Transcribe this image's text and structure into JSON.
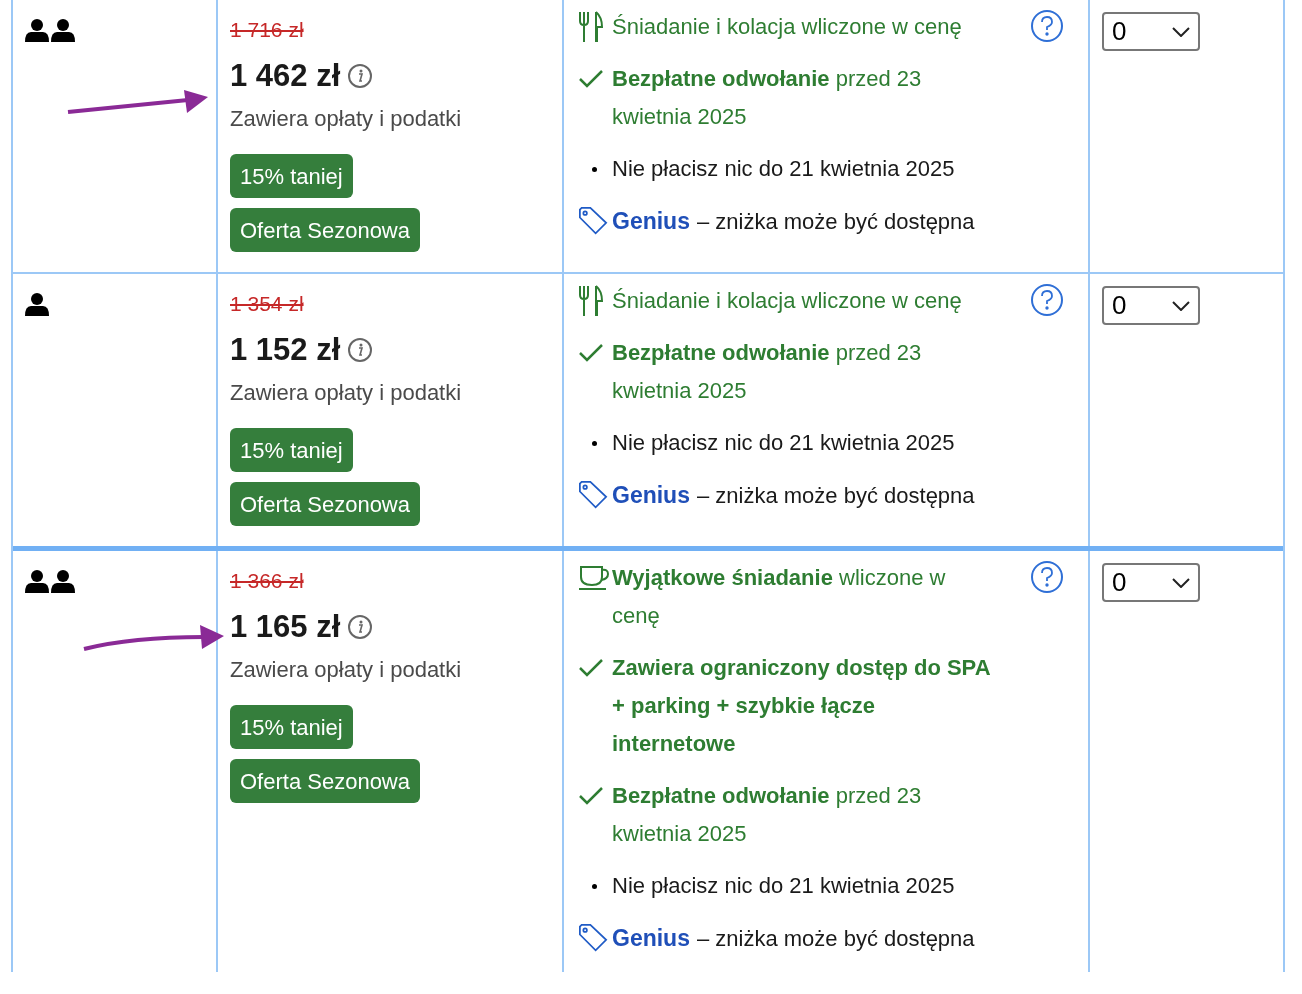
{
  "rows": [
    {
      "occupancy": {
        "kind": "two_persons"
      },
      "arrow": {
        "kind": "straight"
      },
      "old_price": "1 716 zł",
      "price": "1 462 zł",
      "price_note": "Zawiera opłaty i podatki",
      "badges": [
        "15% taniej",
        "Oferta Sezonowa"
      ],
      "features": [
        {
          "kind": "meal",
          "text": "Śniadanie i kolacja wliczone w cenę",
          "help": true
        },
        {
          "kind": "check",
          "text": "**Bezpłatne odwołanie** przed 23 kwietnia 2025",
          "help": false
        },
        {
          "kind": "bullet",
          "text": "Nie płacisz nic do 21 kwietnia 2025",
          "help": false
        },
        {
          "kind": "genius",
          "brand": "Genius",
          "text": "– zniżka może być dostępna",
          "help": false
        }
      ],
      "select": {
        "value": "0"
      }
    },
    {
      "occupancy": {
        "kind": "one_person"
      },
      "old_price": "1 354 zł",
      "price": "1 152 zł",
      "price_note": "Zawiera opłaty i podatki",
      "badges": [
        "15% taniej",
        "Oferta Sezonowa"
      ],
      "features": [
        {
          "kind": "meal",
          "text": "Śniadanie i kolacja wliczone w cenę",
          "help": true
        },
        {
          "kind": "check",
          "text": "**Bezpłatne odwołanie** przed 23 kwietnia 2025",
          "help": false
        },
        {
          "kind": "bullet",
          "text": "Nie płacisz nic do 21 kwietnia 2025",
          "help": false
        },
        {
          "kind": "genius",
          "brand": "Genius",
          "text": "– zniżka może być dostępna",
          "help": false
        }
      ],
      "select": {
        "value": "0"
      }
    },
    {
      "occupancy": {
        "kind": "two_persons"
      },
      "arrow": {
        "kind": "curved"
      },
      "old_price": "1 366 zł",
      "price": "1 165 zł",
      "price_note": "Zawiera opłaty i podatki",
      "badges": [
        "15% taniej",
        "Oferta Sezonowa"
      ],
      "features": [
        {
          "kind": "breakfast",
          "text": "**Wyjątkowe śniadanie** wliczone w cenę",
          "help": true
        },
        {
          "kind": "check",
          "text": "**Zawiera ograniczony dostęp do SPA + parking + szybkie łącze internetowe**",
          "help": false
        },
        {
          "kind": "check",
          "text": "**Bezpłatne odwołanie** przed 23 kwietnia 2025",
          "help": false
        },
        {
          "kind": "bullet",
          "text": "Nie płacisz nic do 21 kwietnia 2025",
          "help": false
        },
        {
          "kind": "genius",
          "brand": "Genius",
          "text": "– zniżka może być dostępna",
          "help": false
        }
      ],
      "select": {
        "value": "0"
      }
    }
  ]
}
